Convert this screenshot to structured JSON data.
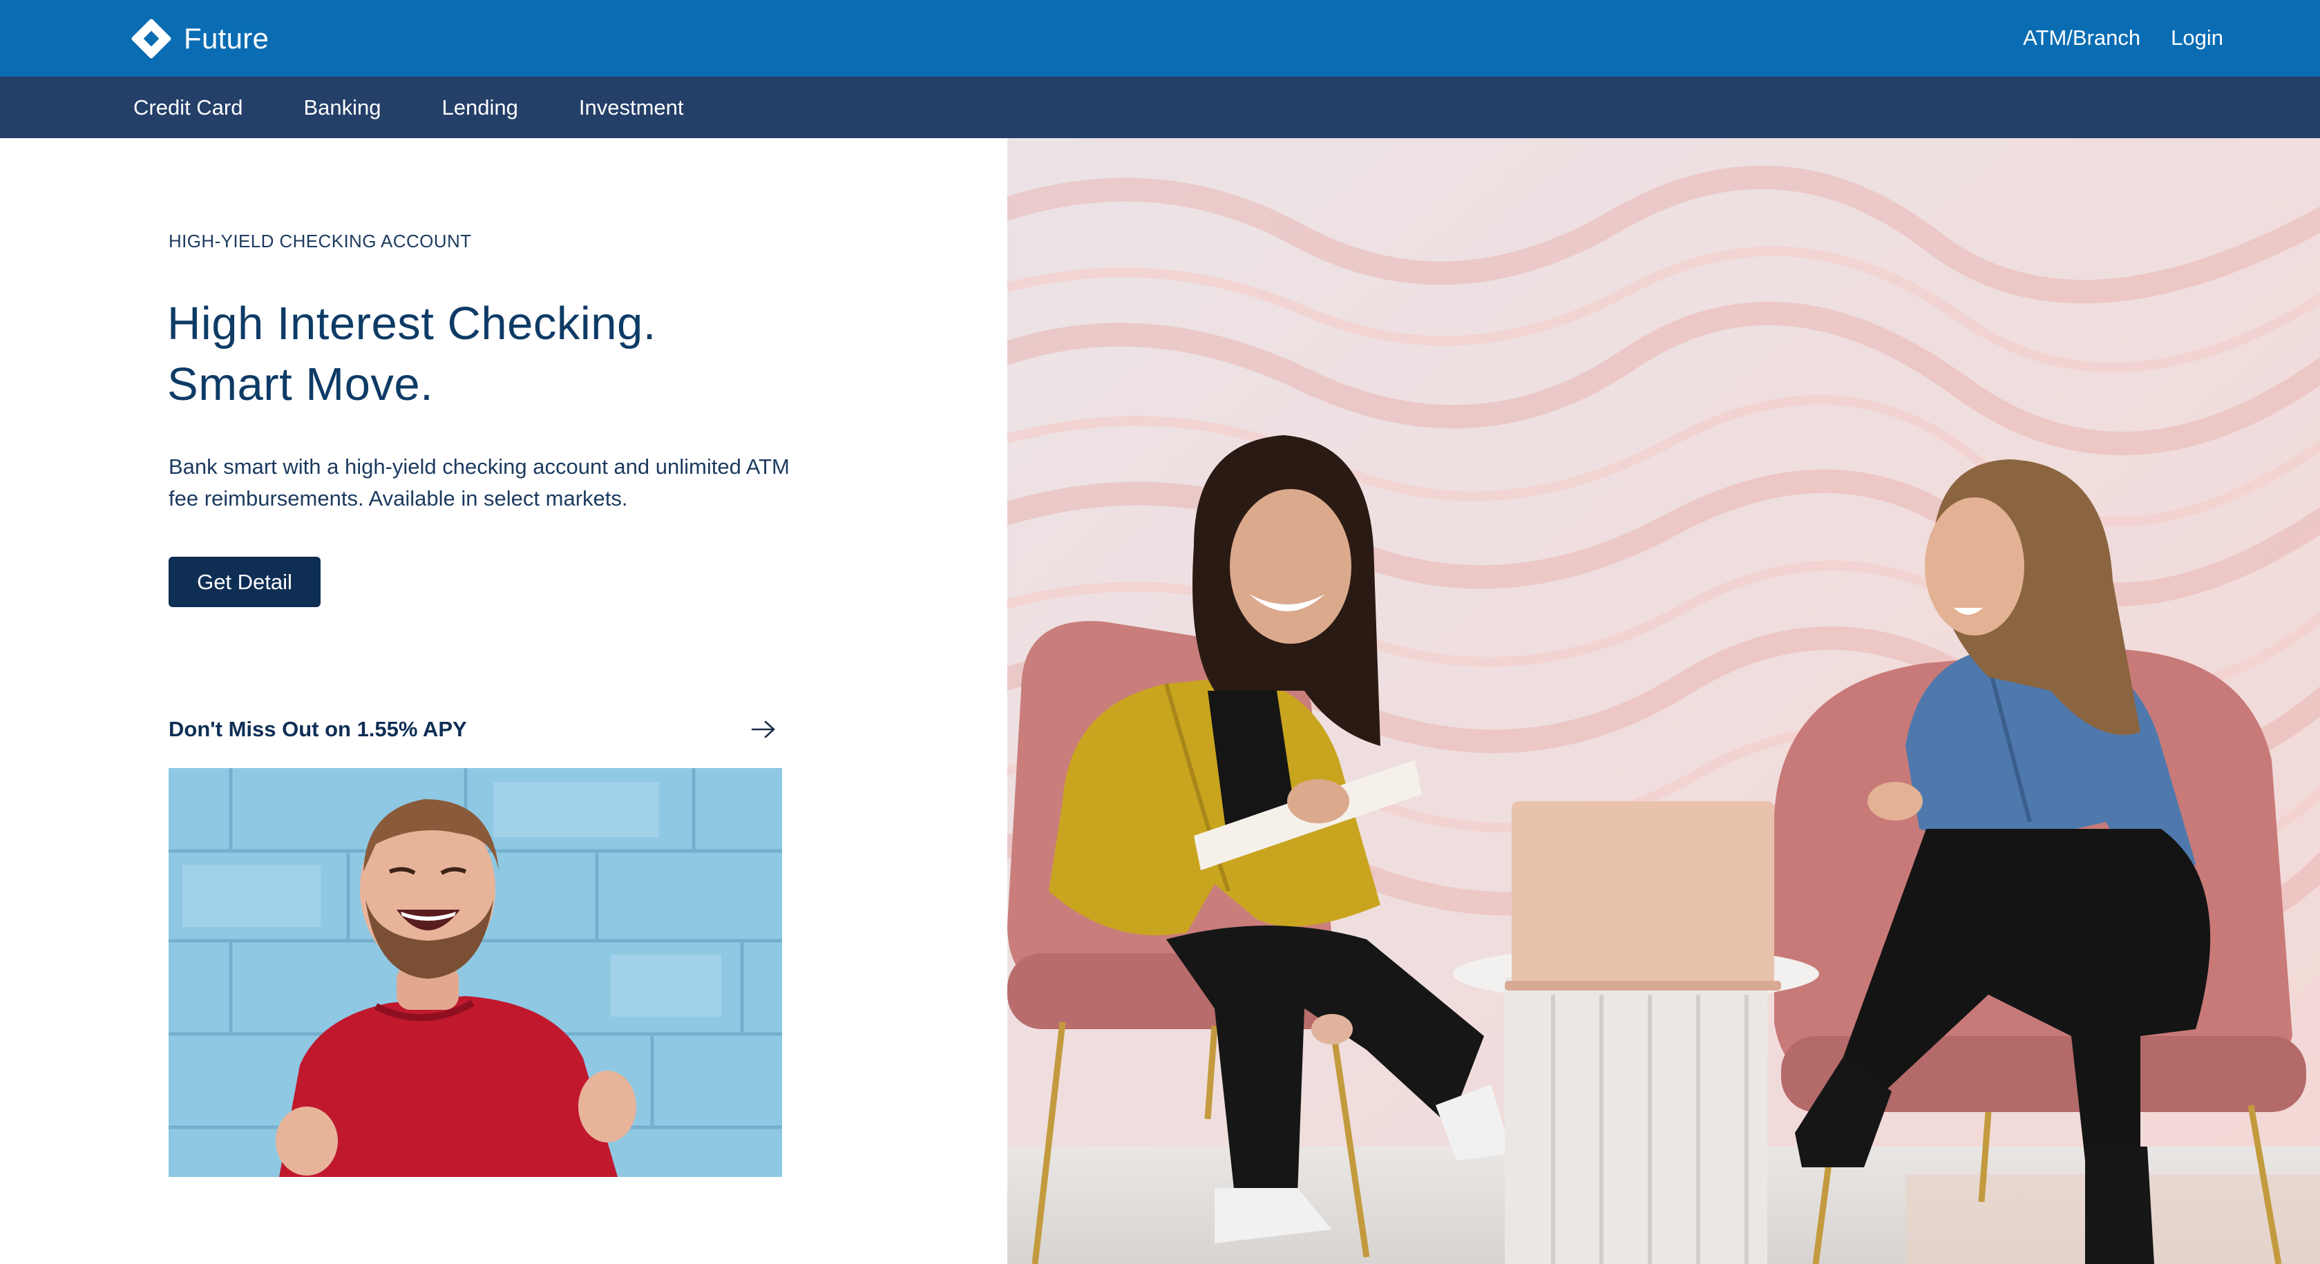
{
  "header": {
    "brand_name": "Future",
    "links": [
      "ATM/Branch",
      "Login"
    ],
    "bg_color": "#0a6db3"
  },
  "nav": {
    "items": [
      "Credit Card",
      "Banking",
      "Lending",
      "Investment"
    ],
    "bg_color": "#243f68"
  },
  "hero": {
    "eyebrow": "HIGH-YIELD CHECKING ACCOUNT",
    "headline_line1": "High Interest Checking.",
    "headline_line2": "Smart Move.",
    "description_line1": "Bank smart with a high-yield checking account and unlimited ATM",
    "description_line2": "fee reimbursements. Available in select markets.",
    "cta_label": "Get Detail",
    "cta_color": "#0f2e54"
  },
  "promo": {
    "title": "Don't Miss Out on 1.55% APY",
    "icon": "arrow-right-icon"
  }
}
